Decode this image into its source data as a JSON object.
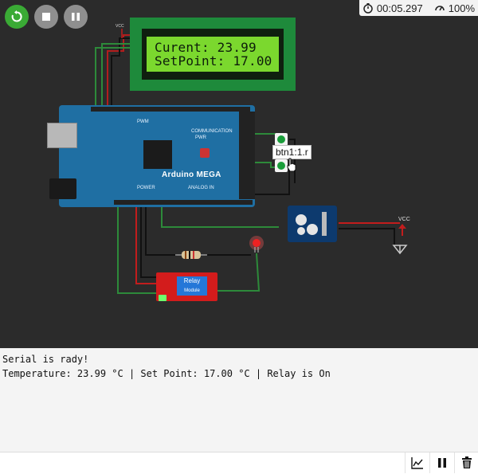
{
  "toolbar": {
    "restart_icon": "restart-icon",
    "stop_icon": "stop-icon",
    "pause_icon": "pause-icon",
    "accent": "#3aaa35",
    "gray": "#9a9a9a"
  },
  "status": {
    "elapsed": "00:05.297",
    "speed": "100%"
  },
  "lcd": {
    "line1": "Curent: 23.99",
    "line2": "SetPoint: 17.00"
  },
  "board": {
    "name": "Arduino MEGA",
    "power_label": "POWER",
    "analog_label": "ANALOG IN",
    "comm_label": "COMMUNICATION",
    "pwr_label": "PWR",
    "pwm_label": "PWM"
  },
  "pins": {
    "vcc_top": "VCC",
    "vcc_right": "VCC"
  },
  "button_tooltip": "btn1:1.r",
  "relay": {
    "title": "Relay",
    "subtitle": "Module"
  },
  "serial": {
    "lines": [
      "Serial is rady!",
      "Temperature: 23.99 °C | Set Point: 17.00 °C | Relay is On"
    ],
    "input_placeholder": ""
  },
  "bottom_tools": {
    "chart_icon": "chart-icon",
    "pause_icon": "pause-icon",
    "trash_icon": "trash-icon"
  }
}
